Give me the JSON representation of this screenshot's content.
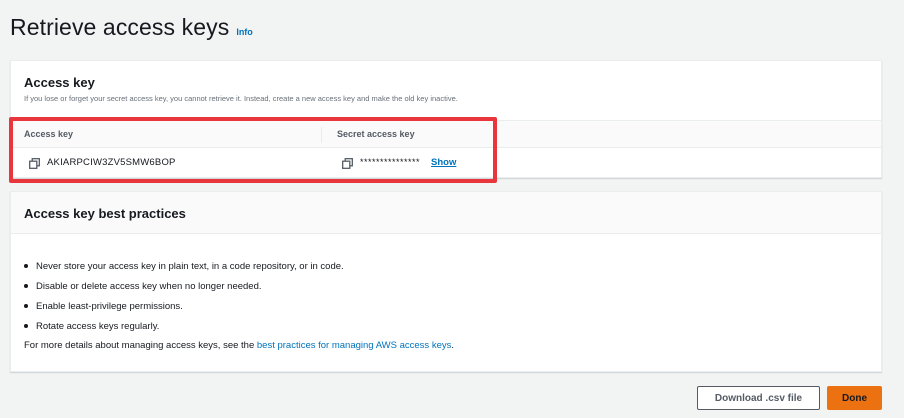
{
  "page": {
    "title": "Retrieve access keys",
    "info_label": "Info"
  },
  "access_key_panel": {
    "title": "Access key",
    "description": "If you lose or forget your secret access key, you cannot retrieve it. Instead, create a new access key and make the old key inactive.",
    "columns": [
      "Access key",
      "Secret access key"
    ],
    "access_key_value": "AKIARPCIW3ZV5SMW6BOP",
    "secret_mask": "***************",
    "show_label": "Show",
    "icons": {
      "copy": "copy-icon"
    },
    "highlight_color": "#e8363c"
  },
  "best_practices": {
    "title": "Access key best practices",
    "items": [
      "Never store your access key in plain text, in a code repository, or in code.",
      "Disable or delete access key when no longer needed.",
      "Enable least-privilege permissions.",
      "Rotate access keys regularly."
    ],
    "footer_prefix": "For more details about managing access keys, see the ",
    "footer_link": "best practices for managing AWS access keys",
    "footer_suffix": "."
  },
  "actions": {
    "download_label": "Download .csv file",
    "done_label": "Done"
  },
  "colors": {
    "primary": "#ec7211",
    "link": "#0073bb",
    "highlight": "#e8363c"
  }
}
